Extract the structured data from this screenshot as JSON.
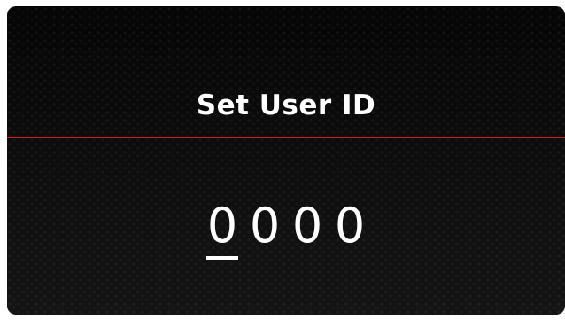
{
  "screen": {
    "title": "Set User ID",
    "accent_color": "#cc1e22",
    "digits": [
      "0",
      "0",
      "0",
      "0"
    ],
    "selected_digit_index": 0
  }
}
